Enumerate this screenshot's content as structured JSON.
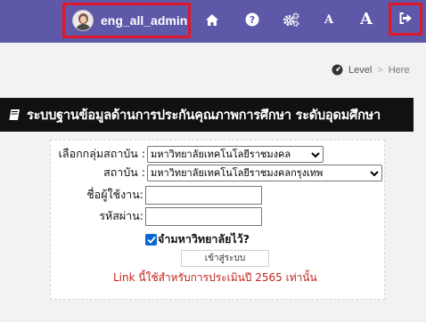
{
  "header": {
    "username": "eng_all_admin",
    "icons": [
      "home-icon",
      "help-icon",
      "gear-icon",
      "font-small-icon",
      "font-large-icon",
      "logout-icon"
    ],
    "font_small_label": "A",
    "font_large_label": "A",
    "background": "#5e58a8",
    "highlight": "#e0182a"
  },
  "breadcrumb": {
    "items": [
      "Level",
      "Here"
    ],
    "separator": ">"
  },
  "title": "ระบบฐานข้อมูลด้านการประกันคุณภาพการศึกษา ระดับอุดมศึกษา",
  "form": {
    "group_label": "เลือกกลุ่มสถาบัน :",
    "group_value": "มหาวิทยาลัยเทคโนโลยีราชมงคล",
    "institution_label": "สถาบัน :",
    "institution_value": "มหาวิทยาลัยเทคโนโลยีราชมงคลกรุงเทพ",
    "username_label": "ชื่อผู้ใช้งาน:",
    "username_value": "",
    "password_label": "รหัสผ่าน:",
    "password_value": "",
    "remember_label": "จำมหาวิทยาลัยไว้?",
    "remember_checked": true,
    "submit_label": "เข้าสู่ระบบ",
    "note": "Link นี้ใช้สำหรับการประเมินปี 2565 เท่านั้น",
    "note_color": "#c0241a"
  }
}
